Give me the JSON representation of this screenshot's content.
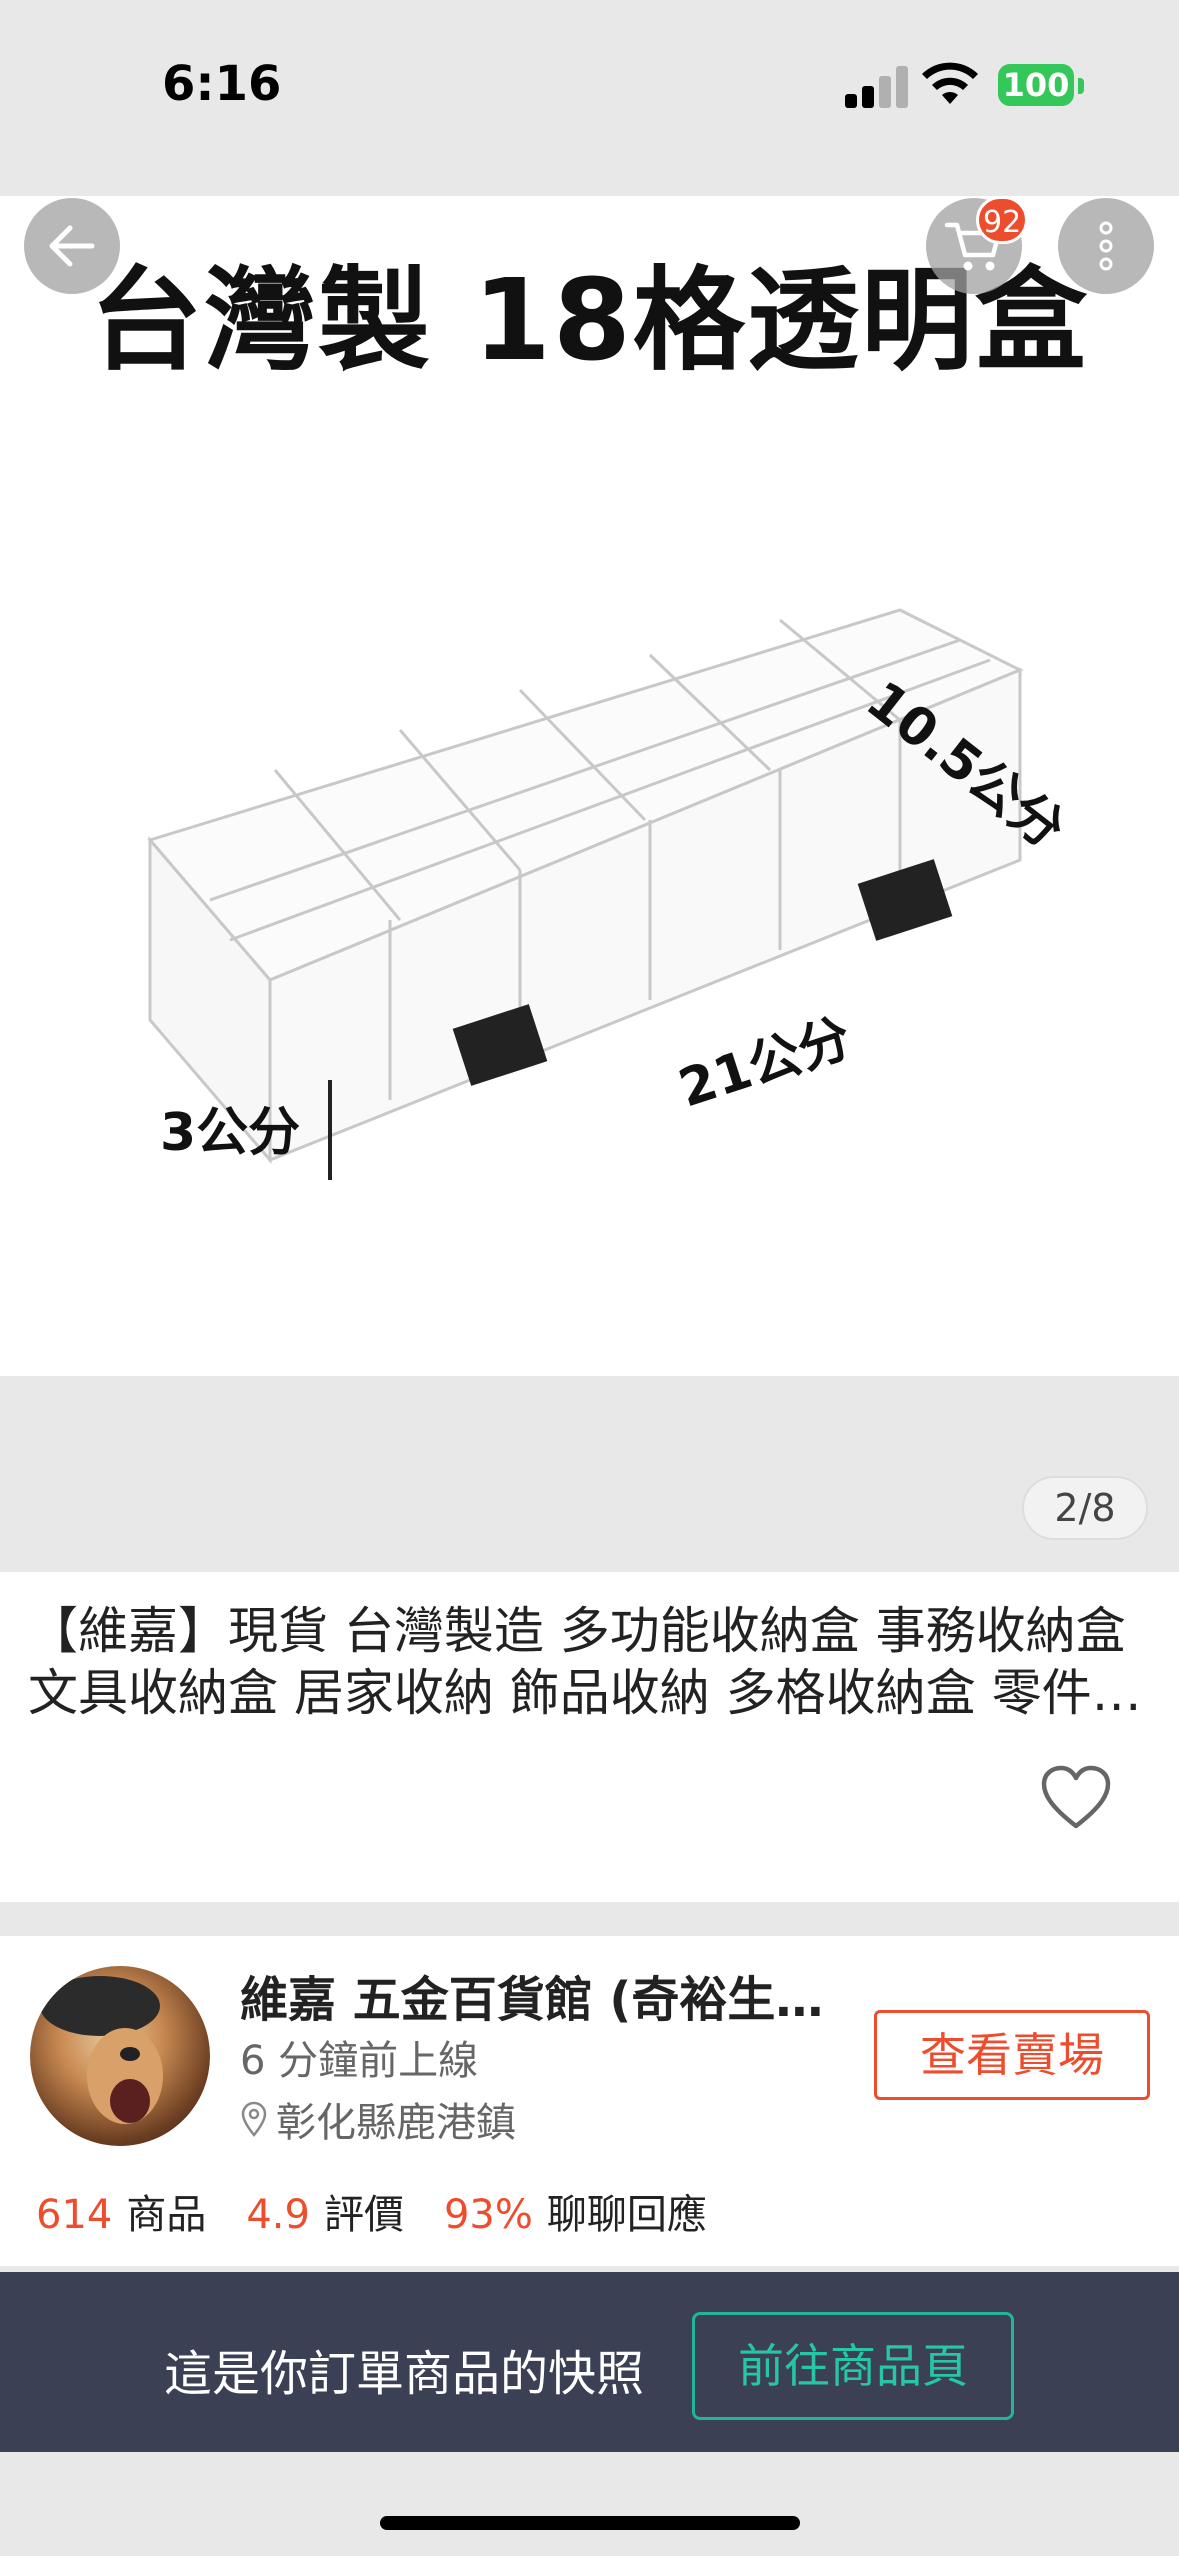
{
  "status_bar": {
    "time": "6:16",
    "battery": "100"
  },
  "cart": {
    "badge_count": "92"
  },
  "product_image": {
    "headline": "台灣製 18格透明盒",
    "dim_width": "10.5公分",
    "dim_length": "21公分",
    "dim_height": "3公分"
  },
  "pager": {
    "label": "2/8"
  },
  "product": {
    "title": "【維嘉】現貨 台灣製造 多功能收納盒 事務收納盒 文具收納盒 居家收納 飾品收納 多格收納盒 零件收納盒"
  },
  "shop": {
    "name": "維嘉 五金百貨館 (奇裕生活館)",
    "online_status": "6 分鐘前上線",
    "location": "彰化縣鹿港鎮",
    "view_button": "查看賣場",
    "stats": [
      {
        "value": "614",
        "label": "商品"
      },
      {
        "value": "4.9",
        "label": "評價"
      },
      {
        "value": "93%",
        "label": "聊聊回應"
      }
    ]
  },
  "snapshot_bar": {
    "message": "這是你訂單商品的快照",
    "button": "前往商品頁"
  },
  "colors": {
    "accent": "#ee4d2d",
    "snapshot_bg": "#3b4055",
    "snapshot_button": "#26c6a6",
    "battery": "#34c759"
  },
  "icons": [
    "back-arrow-icon",
    "cart-icon",
    "more-vertical-icon",
    "heart-icon",
    "location-pin-icon",
    "signal-icon",
    "wifi-icon"
  ]
}
